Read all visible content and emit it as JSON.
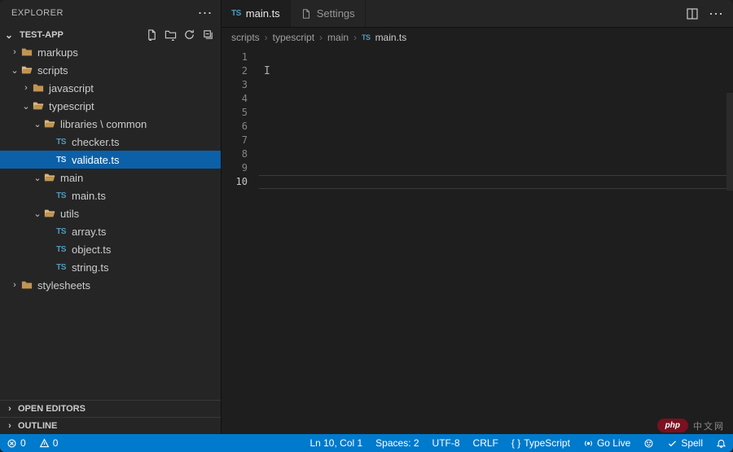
{
  "sidebar": {
    "title": "EXPLORER",
    "project": "TEST-APP",
    "sections": {
      "open_editors": "OPEN EDITORS",
      "outline": "OUTLINE"
    },
    "tree": {
      "markups": "markups",
      "scripts": "scripts",
      "javascript": "javascript",
      "typescript": "typescript",
      "libraries_common": "libraries \\ common",
      "checker": "checker.ts",
      "validate": "validate.ts",
      "main": "main",
      "main_ts": "main.ts",
      "utils": "utils",
      "array": "array.ts",
      "object": "object.ts",
      "string": "string.ts",
      "stylesheets": "stylesheets"
    }
  },
  "tabs": {
    "main_ts": "main.ts",
    "settings": "Settings"
  },
  "breadcrumbs": {
    "p1": "scripts",
    "p2": "typescript",
    "p3": "main",
    "p4": "main.ts"
  },
  "editor": {
    "line_numbers": [
      "1",
      "2",
      "3",
      "4",
      "5",
      "6",
      "7",
      "8",
      "9",
      "10"
    ],
    "current_line": 10
  },
  "status": {
    "errors": "0",
    "warnings": "0",
    "ln_col": "Ln 10, Col 1",
    "spaces": "Spaces: 2",
    "encoding": "UTF-8",
    "eol": "CRLF",
    "lang": "TypeScript",
    "golive": "Go Live",
    "spell": "Spell"
  },
  "watermark": {
    "pill": "php",
    "text": "中文网"
  }
}
